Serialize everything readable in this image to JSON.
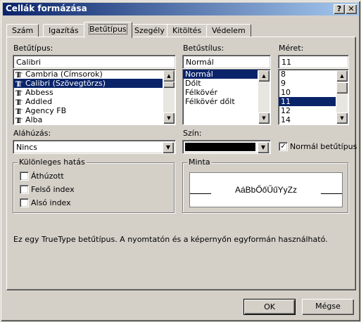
{
  "window": {
    "title": "Cellák formázása",
    "help_label": "?",
    "close_label": "✕"
  },
  "tabs": [
    {
      "label": "Szám"
    },
    {
      "label": "Igazítás"
    },
    {
      "label": "Betűtípus",
      "active": true
    },
    {
      "label": "Szegély"
    },
    {
      "label": "Kitöltés"
    },
    {
      "label": "Védelem"
    }
  ],
  "font": {
    "label": "Betűtípus:",
    "value": "Calibri",
    "items": [
      {
        "label": "Cambria (Címsorok)",
        "icon": "truetype-icon"
      },
      {
        "label": "Calibri (Szövegtörzs)",
        "icon": "truetype-icon",
        "selected": true
      },
      {
        "label": "Abbess",
        "icon": "truetype-icon"
      },
      {
        "label": "Addled",
        "icon": "truetype-icon"
      },
      {
        "label": "Agency FB",
        "icon": "truetype-icon"
      },
      {
        "label": "Alba",
        "icon": "truetype-icon"
      }
    ]
  },
  "style": {
    "label": "Betűstílus:",
    "value": "Normál",
    "items": [
      {
        "label": "Normál",
        "selected": true
      },
      {
        "label": "Dőlt"
      },
      {
        "label": "Félkövér"
      },
      {
        "label": "Félkövér dőlt"
      }
    ]
  },
  "size": {
    "label": "Méret:",
    "value": "11",
    "items": [
      {
        "label": "8"
      },
      {
        "label": "9"
      },
      {
        "label": "10"
      },
      {
        "label": "11",
        "selected": true
      },
      {
        "label": "12"
      },
      {
        "label": "14"
      }
    ]
  },
  "underline": {
    "label": "Aláhúzás:",
    "value": "Nincs"
  },
  "color": {
    "label": "Szín:",
    "value_hex": "#000000"
  },
  "normal_font": {
    "label": "Normál betűtípus",
    "checked": true
  },
  "effects": {
    "title": "Különleges hatás",
    "items": [
      {
        "label": "Áthúzott",
        "checked": false
      },
      {
        "label": "Felső index",
        "checked": false
      },
      {
        "label": "Alsó index",
        "checked": false
      }
    ]
  },
  "preview": {
    "title": "Minta",
    "sample": "AáBbŐőŰűYyZz"
  },
  "info_text": "Ez egy TrueType betűtípus.  A nyomtatón és a képernyőn egyformán használható.",
  "buttons": {
    "ok": "OK",
    "cancel": "Mégse"
  },
  "colors": {
    "titlebar_start": "#0a246a",
    "titlebar_end": "#a6caf0",
    "selection": "#0a246a",
    "face": "#d4d0c8"
  }
}
